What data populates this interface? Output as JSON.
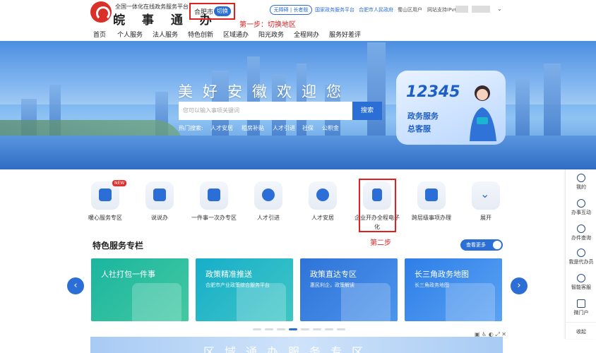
{
  "header": {
    "site_subtitle": "全国一体化在线政务服务平台",
    "site_name": "皖 事 通 办",
    "city": "合肥市",
    "city_switch": "切换",
    "step1_note": "第一步：切换地区",
    "accessibility": "无障碍 | 长者版",
    "links": [
      "国家政务服务平台",
      "合肥市人民政府"
    ],
    "user_text": "蜀山区用户",
    "ipv6": "网站支持IPv6"
  },
  "nav": {
    "items": [
      "首页",
      "个人服务",
      "法人服务",
      "特色创新",
      "区域通办",
      "阳光政务",
      "全程网办",
      "服务好差评"
    ]
  },
  "hero": {
    "title": "美好安徽欢迎您",
    "search_placeholder": "您可以输入事项关键词",
    "search_button": "搜索",
    "hot_label": "热门搜索:",
    "hot_words": [
      "人才安居",
      "租房补贴",
      "人才引进",
      "社保",
      "公积金"
    ],
    "service_card": {
      "number": "12345",
      "line1": "政务服务",
      "line2": "总客服"
    }
  },
  "services": {
    "items": [
      {
        "label": "暖心服务专区",
        "icon": "heart-service-icon",
        "badge": "NEW"
      },
      {
        "label": "说说办",
        "icon": "speak-icon"
      },
      {
        "label": "一件事一次办专区",
        "icon": "one-thing-icon"
      },
      {
        "label": "人才引进",
        "icon": "talent-bulb-icon"
      },
      {
        "label": "人才安居",
        "icon": "housing-bulb-icon"
      },
      {
        "label": "企业开办全程电子化",
        "icon": "document-icon"
      },
      {
        "label": "跨层级事项办理",
        "icon": "cross-level-icon"
      },
      {
        "label": "展开",
        "icon": "chevron-down-icon"
      }
    ],
    "step2_note": "第二步"
  },
  "features": {
    "title": "特色服务专栏",
    "more": "查看更多",
    "cards": [
      {
        "title": "人社打包一件事",
        "sub": "",
        "color": "#1bb5a0"
      },
      {
        "title": "政策精准推送",
        "sub": "合肥市产业政策综合服务平台",
        "color": "#17aecb"
      },
      {
        "title": "政策直达专区",
        "sub": "惠民利企，政策解读",
        "color": "#2f73d8"
      },
      {
        "title": "长三角政务地图",
        "sub": "长三角政务地图",
        "color": "#2d7ee8"
      }
    ],
    "banner": "区域通办服务专区",
    "carousel_active_index": 3,
    "carousel_count": 8
  },
  "sidebar": {
    "items": [
      "我的",
      "办事互动",
      "办件查询",
      "我是代办员",
      "智能客服",
      "微门户",
      "收起"
    ]
  }
}
